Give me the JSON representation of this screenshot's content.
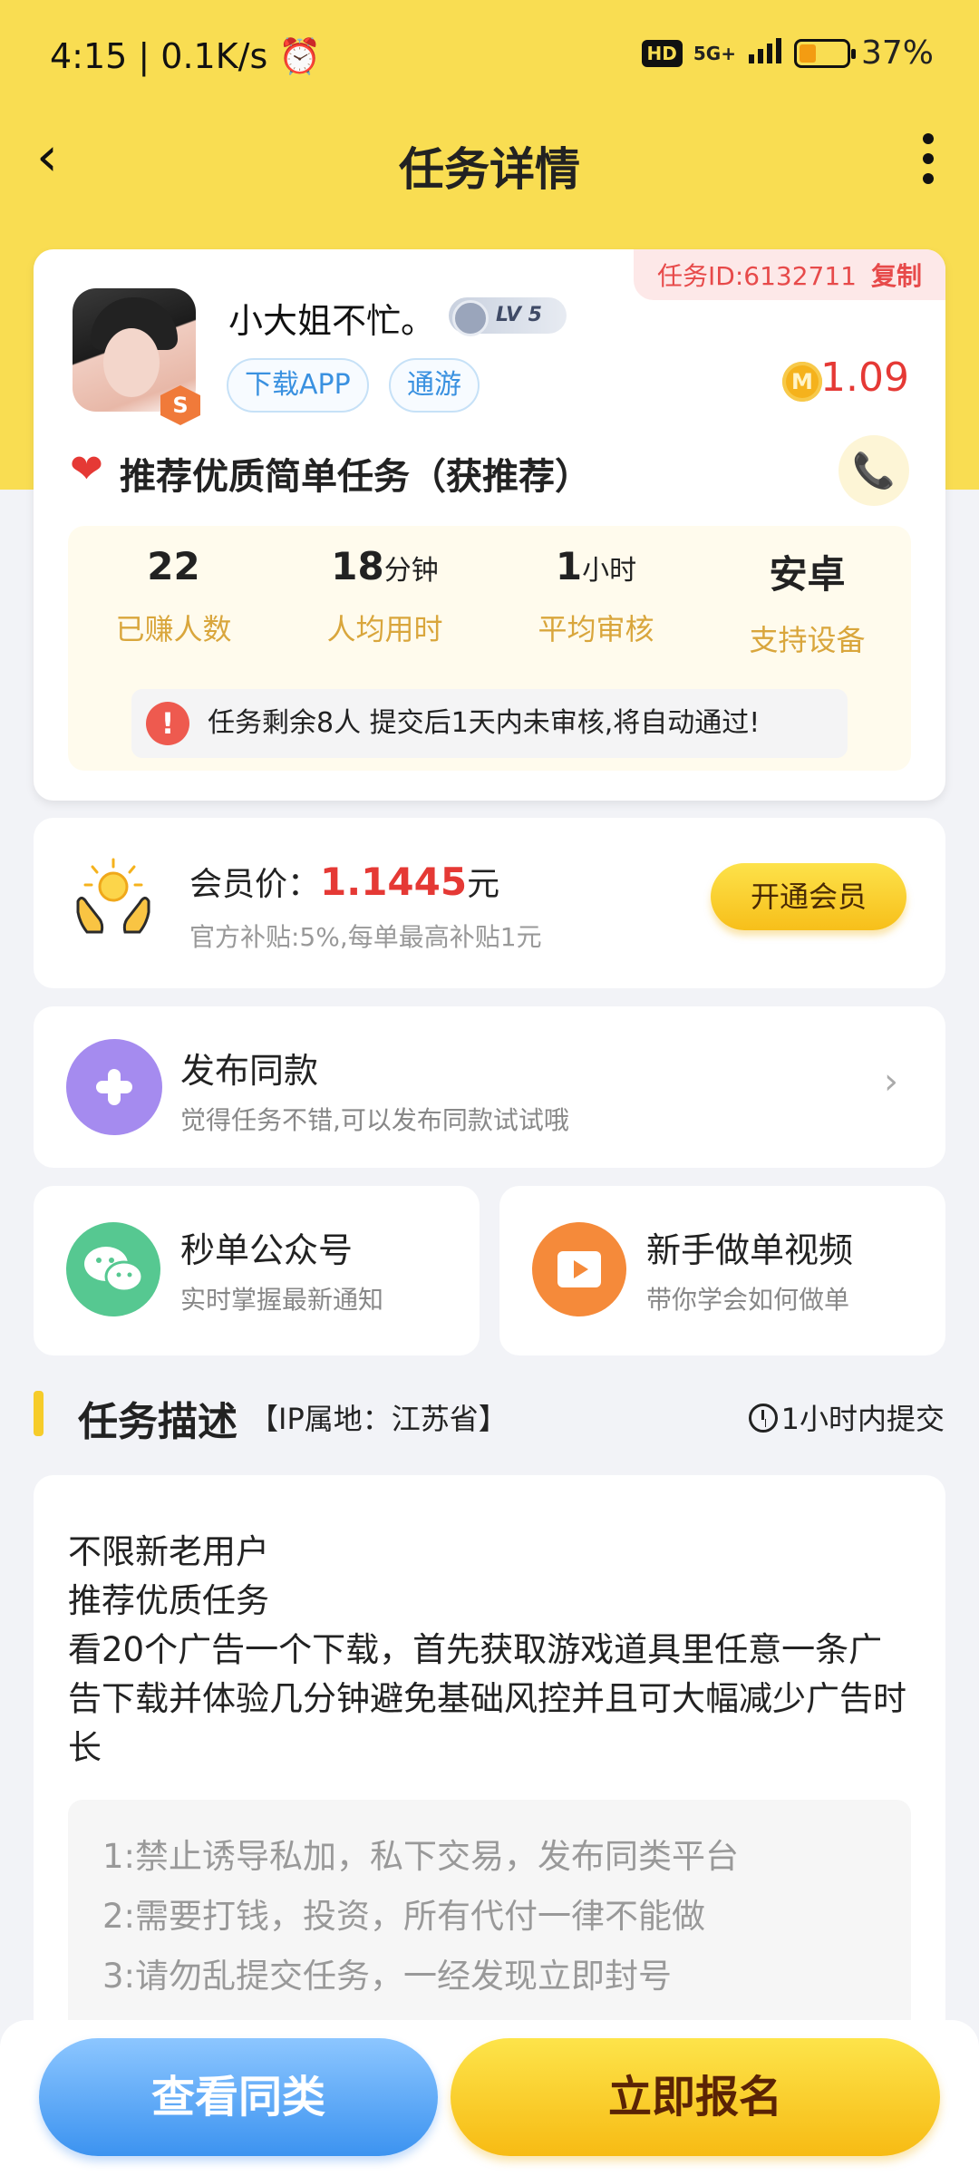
{
  "status_bar": {
    "time": "4:15 | 0.1K/s ⏰",
    "hd": "HD",
    "network": "5G+",
    "battery_level": 0.37,
    "battery": "37%"
  },
  "header": {
    "back_glyph": "‹",
    "title": "任务详情"
  },
  "task": {
    "id_label": "任务ID:6132711",
    "copy_label": "复制",
    "user_name": "小大姐不忙。",
    "level": "LV 5",
    "badge": "S",
    "tags": [
      "下载APP",
      "通游"
    ],
    "coin_symbol": "M",
    "reward": "1.09",
    "heart": "❤",
    "title": "推荐优质简单任务（获推荐）",
    "phone_glyph": "📞",
    "stats": [
      {
        "value": "22",
        "unit": "",
        "label": "已赚人数"
      },
      {
        "value": "18",
        "unit": "分钟",
        "label": "人均用时"
      },
      {
        "value": "1",
        "unit": "小时",
        "label": "平均审核"
      },
      {
        "value": "安卓",
        "unit": "",
        "label": "支持设备"
      }
    ],
    "notice_mark": "!",
    "notice": "任务剩余8人  提交后1天内未审核,将自动通过!"
  },
  "vip": {
    "label": "会员价：",
    "price": "1.1445",
    "unit": "元",
    "subsidy": "官方补贴:5%,每单最高补贴1元",
    "button": "开通会员"
  },
  "publish": {
    "title": "发布同款",
    "subtitle": "觉得任务不错,可以发布同款试试哦",
    "chevron": "›"
  },
  "shortcuts": [
    {
      "title": "秒单公众号",
      "subtitle": "实时掌握最新通知",
      "icon": "wechat-icon"
    },
    {
      "title": "新手做单视频",
      "subtitle": "带你学会如何做单",
      "icon": "video-play-icon"
    }
  ],
  "description": {
    "heading": "任务描述",
    "ip": "【IP属地：江苏省】",
    "deadline": "1小时内提交",
    "lines": [
      "不限新老用户",
      "推荐优质任务",
      "看20个广告一个下载，首先获取游戏道具里任意一条广告下载并体验几分钟避免基础风控并且可大幅减少广告时长"
    ],
    "rules": [
      "1:禁止诱导私加，私下交易，发布同类平台",
      "2:需要打钱，投资，所有代付一律不能做",
      "3:请勿乱提交任务，一经发现立即封号"
    ]
  },
  "bottom_bar": {
    "view_similar": "查看同类",
    "sign_up": "立即报名"
  },
  "colors": {
    "header_yellow": "#f9dd52",
    "reward_red": "#e53935",
    "label_gold": "#d9a63c",
    "tag_blue": "#3a91e0"
  }
}
